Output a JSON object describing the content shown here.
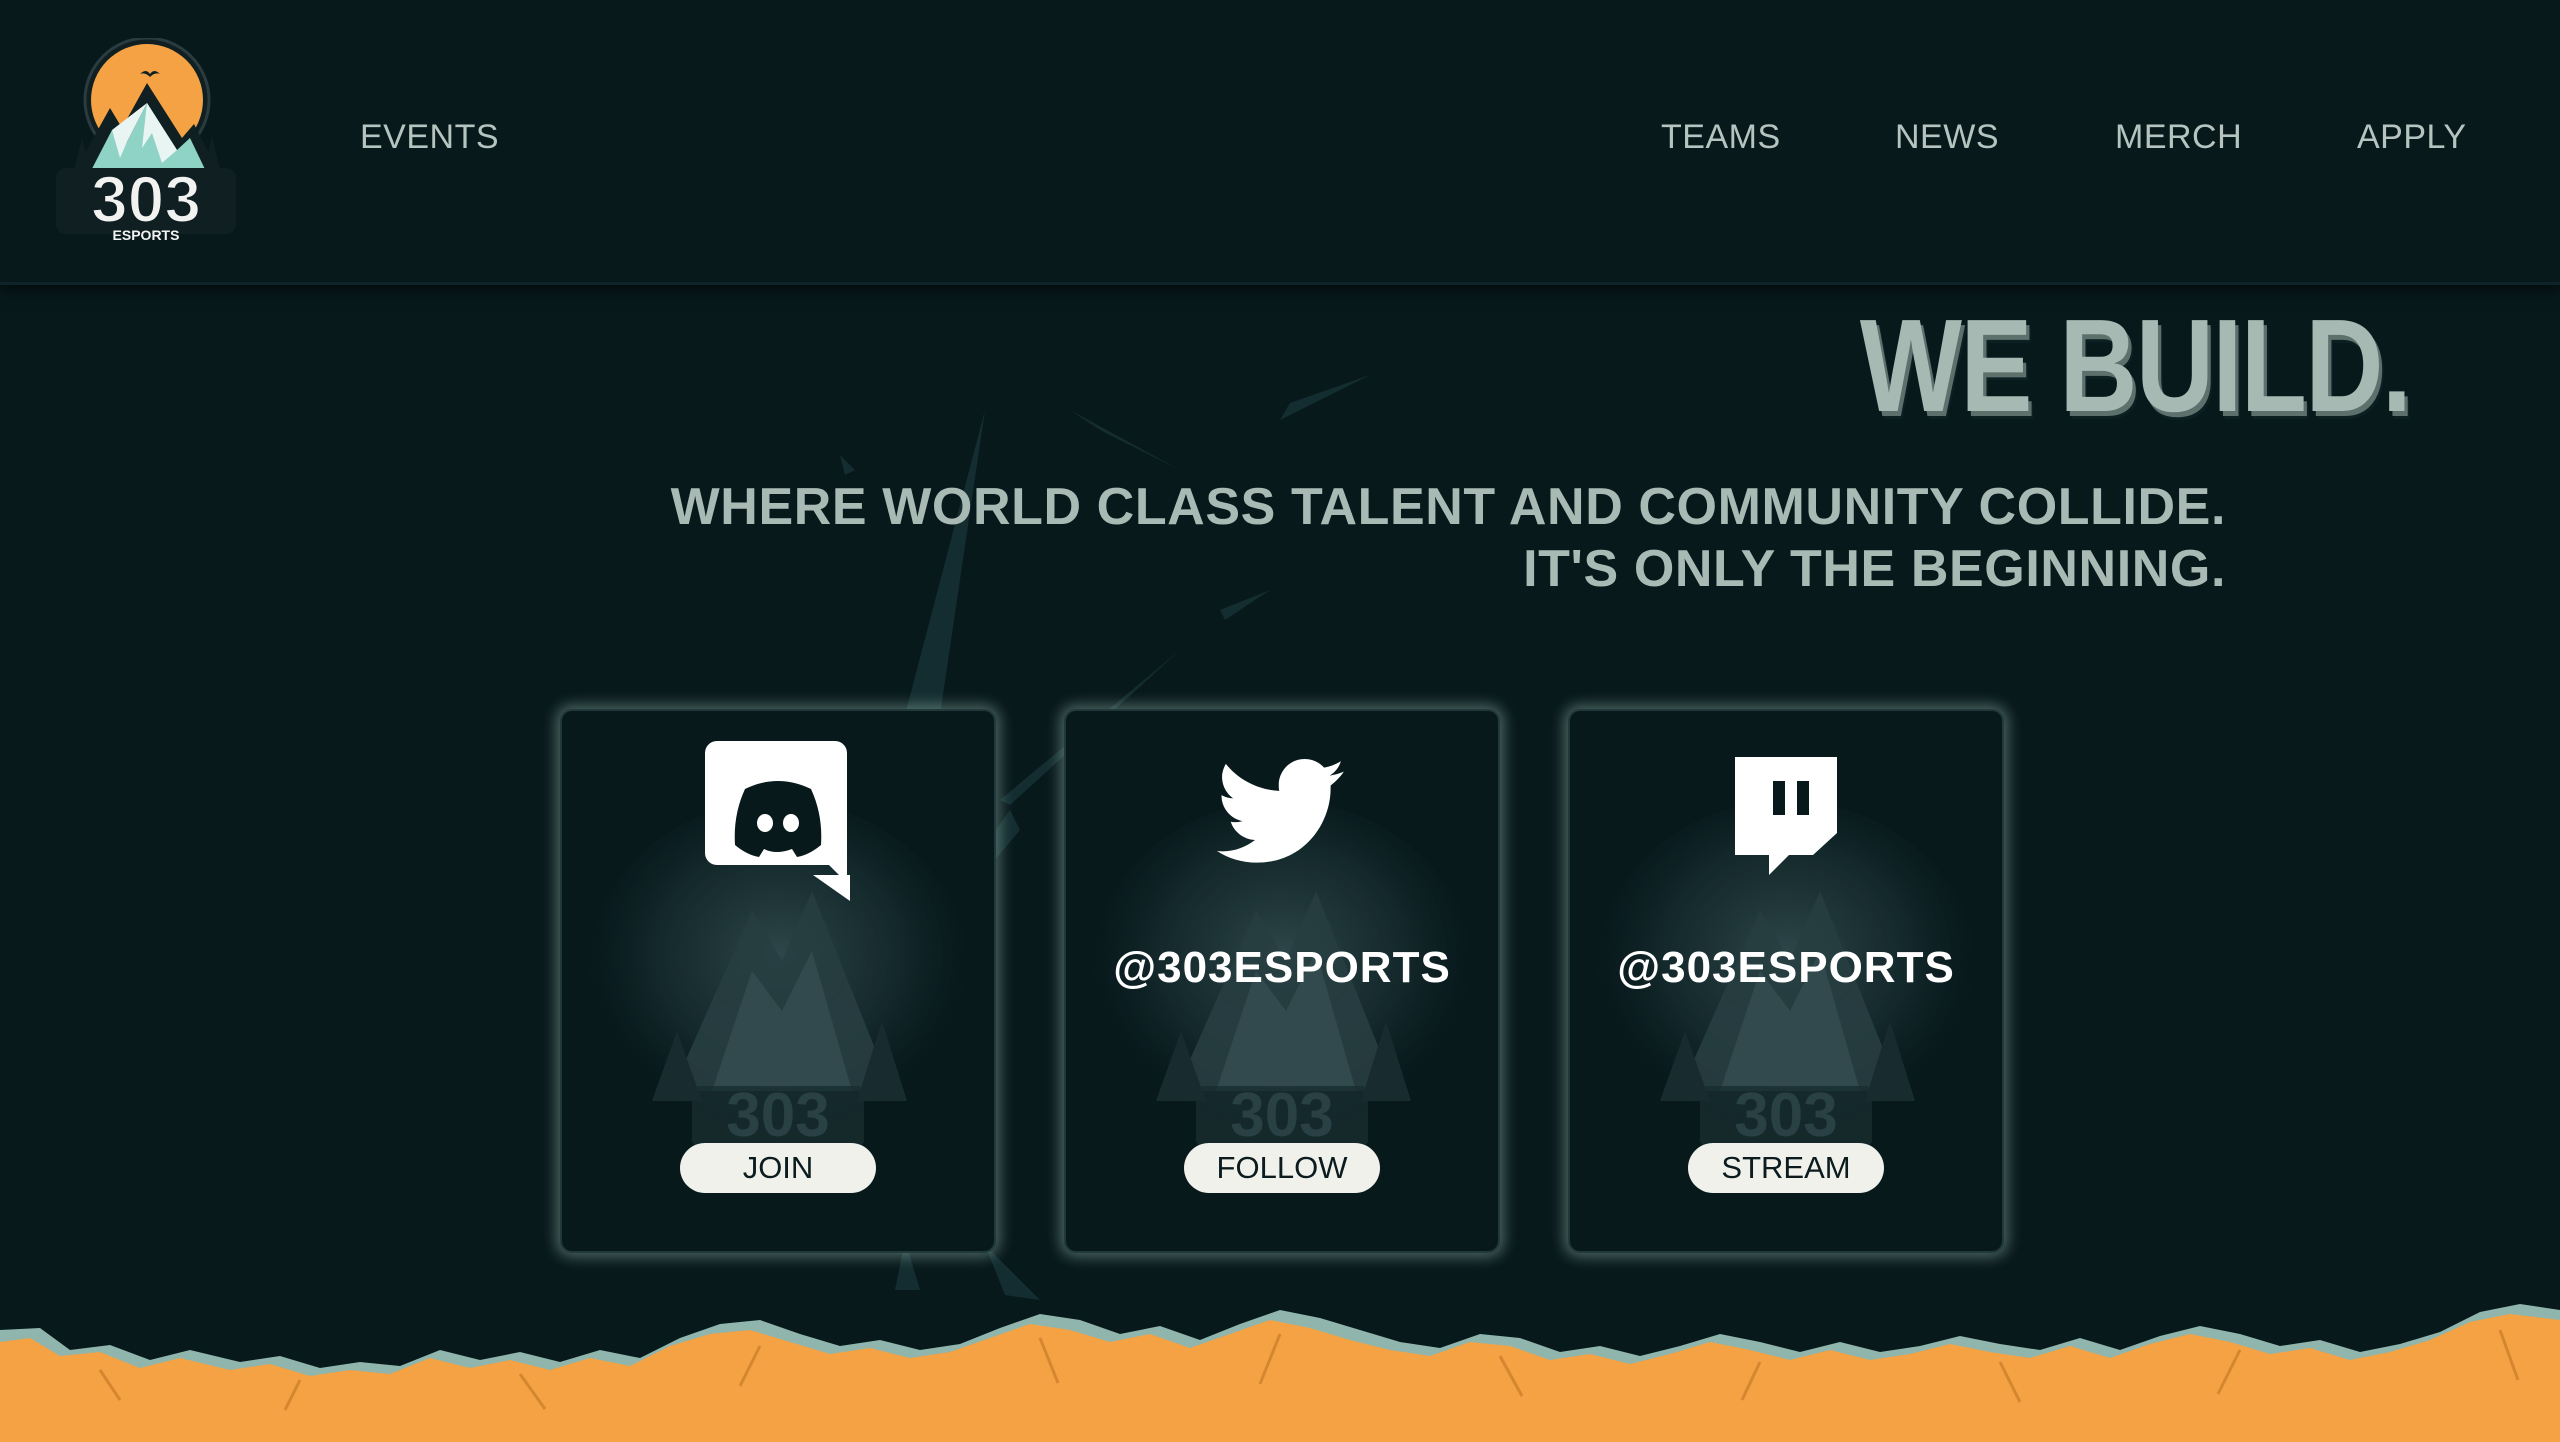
{
  "brand": {
    "logo_number": "303",
    "logo_sub": "ESPORTS"
  },
  "nav": {
    "left": [
      {
        "label": "EVENTS"
      }
    ],
    "right": [
      {
        "label": "TEAMS"
      },
      {
        "label": "NEWS"
      },
      {
        "label": "MERCH"
      },
      {
        "label": "APPLY"
      }
    ]
  },
  "hero": {
    "title": "WE BUILD.",
    "subtitle_line1": "WHERE WORLD CLASS TALENT AND COMMUNITY COLLIDE.",
    "subtitle_line2": "IT'S ONLY THE BEGINNING."
  },
  "cards": [
    {
      "platform": "discord",
      "icon": "discord-icon",
      "handle": "",
      "button": "JOIN"
    },
    {
      "platform": "twitter",
      "icon": "twitter-icon",
      "handle": "@303ESPORTS",
      "button": "FOLLOW"
    },
    {
      "platform": "twitch",
      "icon": "twitch-icon",
      "handle": "@303ESPORTS",
      "button": "STREAM"
    }
  ],
  "colors": {
    "background": "#08191c",
    "accent_orange": "#f4a243",
    "accent_teal": "#8fb5ad",
    "text_muted": "#aab9b5"
  }
}
